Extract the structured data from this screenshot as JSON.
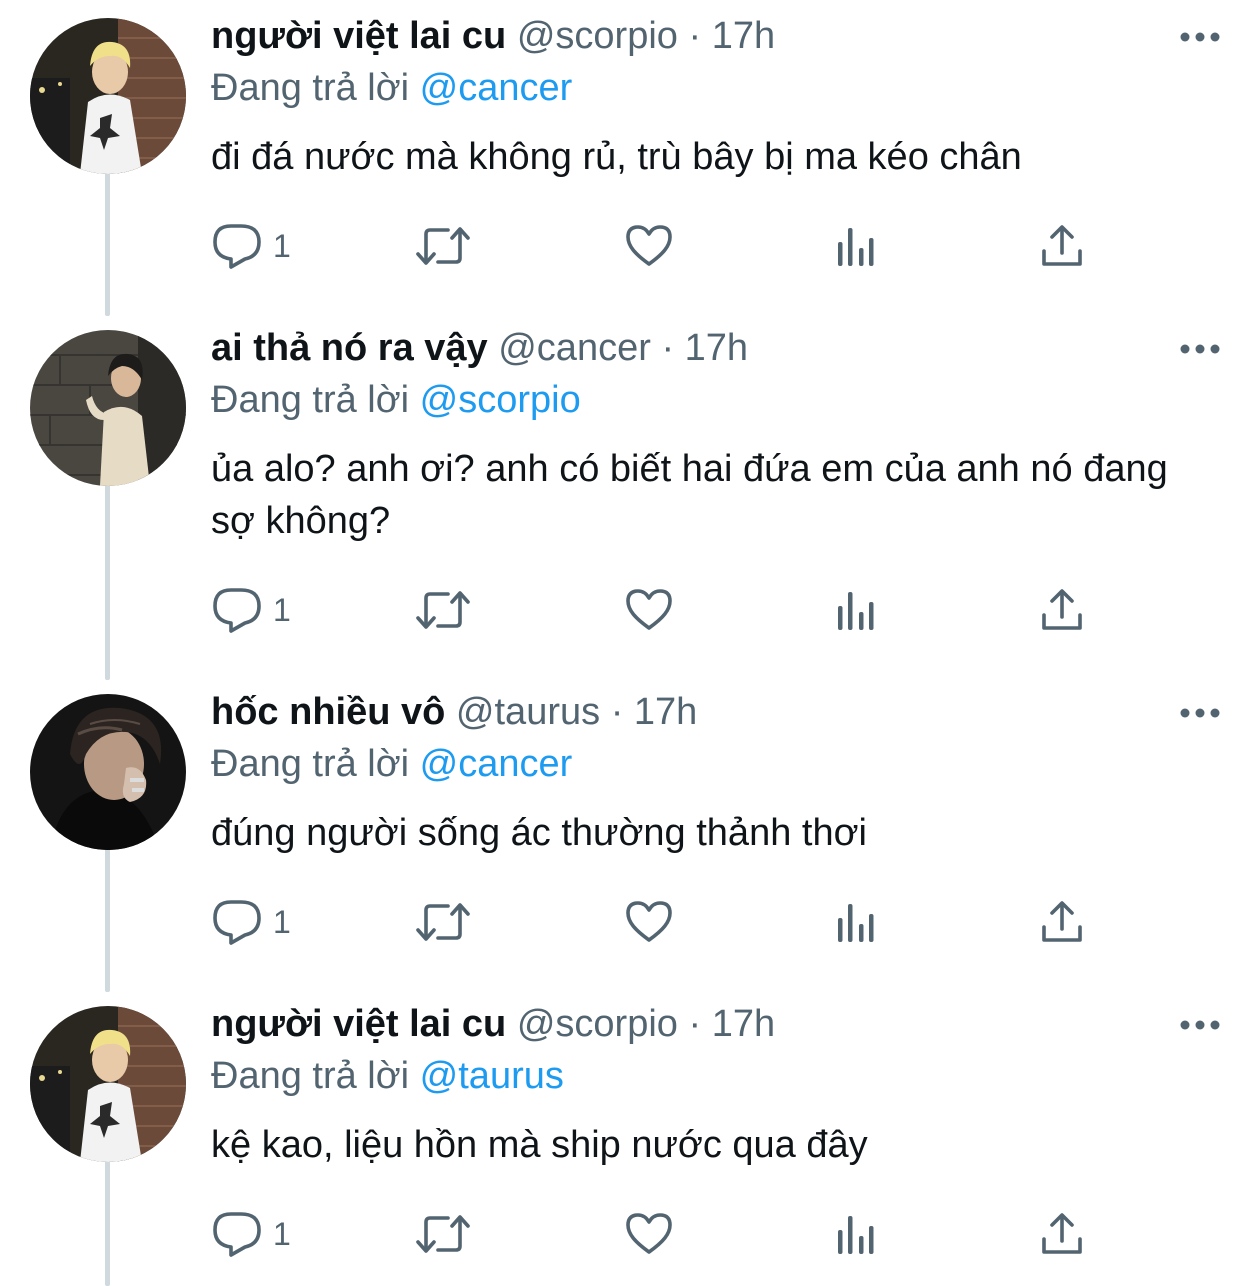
{
  "tweets": [
    {
      "name": "người việt lai cu",
      "handle": "@scorpio",
      "dot": "·",
      "time": "17h",
      "reply_prefix": "Đang trả lời",
      "reply_to": "@cancer",
      "text": "đi đá nước mà không rủ, trù bây bị ma kéo chân",
      "reply_count": "1",
      "avatar": "blond-person-street-night"
    },
    {
      "name": "ai thả nó ra vậy",
      "handle": "@cancer",
      "dot": "·",
      "time": "17h",
      "reply_prefix": "Đang trả lời",
      "reply_to": "@scorpio",
      "text": "ủa alo? anh ơi? anh có biết hai đứa em của anh nó đang sợ không?",
      "reply_count": "1",
      "avatar": "person-leaning-stone-wall"
    },
    {
      "name": "hốc nhiều vô",
      "handle": "@taurus",
      "dot": "·",
      "time": "17h",
      "reply_prefix": "Đang trả lời",
      "reply_to": "@cancer",
      "text": "đúng người sống ác thường thảnh thơi",
      "reply_count": "1",
      "avatar": "dark-haired-person-closeup"
    },
    {
      "name": "người việt lai cu",
      "handle": "@scorpio",
      "dot": "·",
      "time": "17h",
      "reply_prefix": "Đang trả lời",
      "reply_to": "@taurus",
      "text": "kệ kao, liệu hồn mà ship nước qua đây",
      "reply_count": "1",
      "avatar": "blond-person-street-night"
    }
  ],
  "icons": {
    "reply": "reply-icon",
    "retweet": "retweet-icon",
    "like": "heart-icon",
    "views": "views-icon",
    "share": "share-icon",
    "more": "more-icon"
  },
  "colors": {
    "link": "#1d9bf0",
    "muted": "#536471",
    "text": "#0f1419",
    "thread": "#cfd9de"
  }
}
